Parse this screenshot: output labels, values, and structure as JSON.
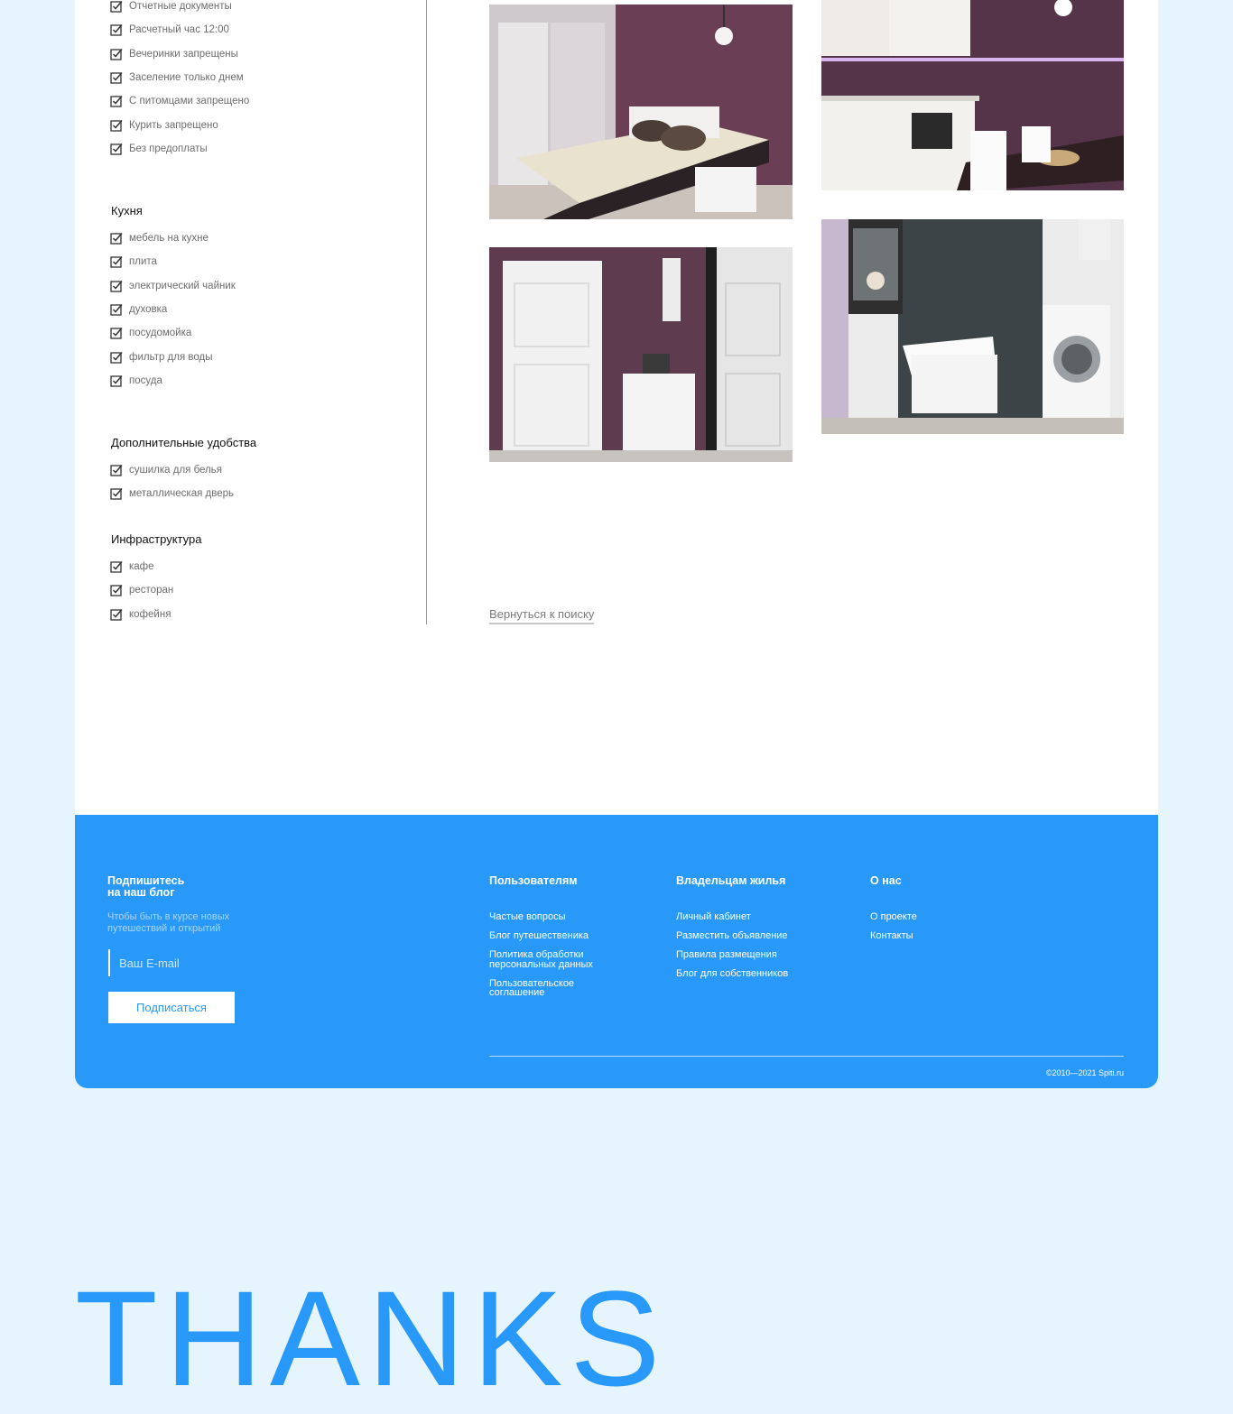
{
  "rules": {
    "items": [
      "Отчетные документы",
      "Расчетный час 12:00",
      "Вечеринки запрещены",
      "Заселение только днем",
      "С питомцами запрещено",
      "Курить запрещено",
      "Без предоплаты"
    ]
  },
  "kitchen": {
    "title": "Кухня",
    "items": [
      "мебель на кухне",
      "плита",
      "электрический чайник",
      "духовка",
      "посудомойка",
      "фильтр для воды",
      "посуда"
    ]
  },
  "extras": {
    "title": "Дополнительные удобства",
    "items": [
      "сушилка для белья",
      "металлическая дверь"
    ]
  },
  "infra": {
    "title": "Инфраструктура",
    "items": [
      "кафе",
      "ресторан",
      "кофейня"
    ]
  },
  "gallery": {
    "back_link": "Вернуться к поиску"
  },
  "footer": {
    "subscribe_title_1": "Подпишитесь",
    "subscribe_title_2": "на наш блог",
    "subscribe_sub_1": "Чтобы быть в курсе новых",
    "subscribe_sub_2": "путешествий и открытий",
    "email_placeholder": "Ваш E-mail",
    "subscribe_button": "Подписаться",
    "users": {
      "title": "Пользователям",
      "links": [
        "Частые вопросы",
        "Блог путешественика",
        "Политика обработки персональных данных",
        "Пользовательское соглашение"
      ]
    },
    "owners": {
      "title": "Владельцам жилья",
      "links": [
        "Личный кабинет",
        "Разместить объявление",
        "Правила размещения",
        "Блог для собственников"
      ]
    },
    "about": {
      "title": "О нас",
      "links": [
        "О проекте",
        "Контакты"
      ]
    },
    "copyright": "©2010—2021 Spiti.ru"
  },
  "thanks": "THANKS",
  "colors": {
    "accent": "#2899F9",
    "background": "#E6F4FE",
    "card": "#FFFFFF"
  }
}
